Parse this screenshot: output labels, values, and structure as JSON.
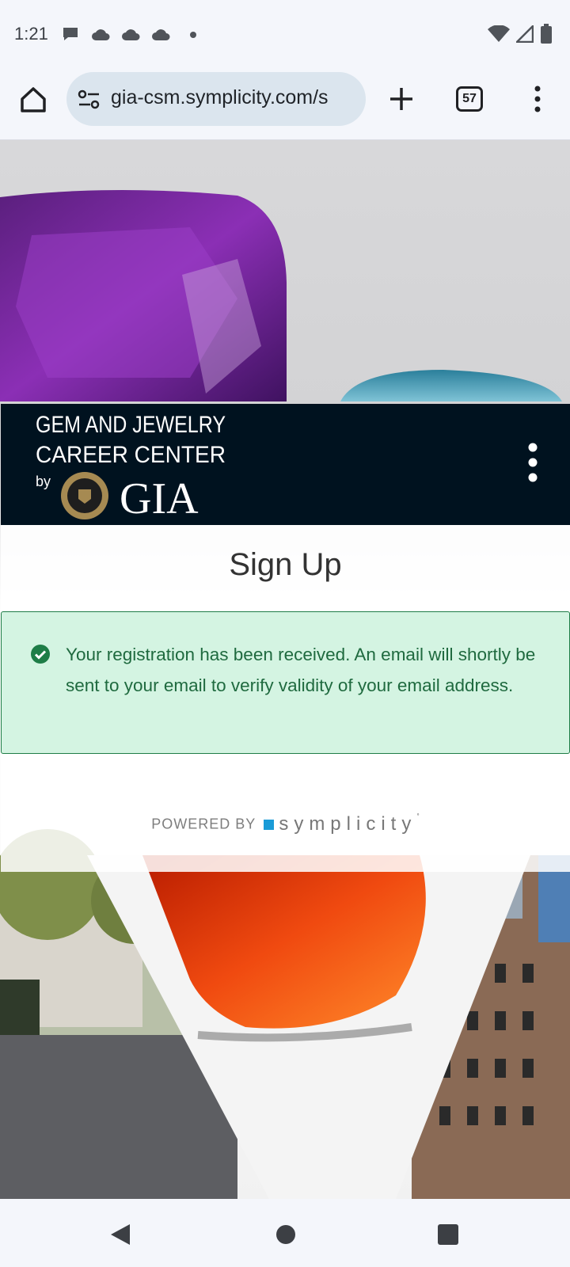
{
  "status_bar": {
    "time": "1:21",
    "notification_icons": [
      "chat-bubble-icon",
      "cloud-icon",
      "cloud-icon",
      "cloud-icon",
      "dot-icon"
    ],
    "right_icons": [
      "wifi-icon",
      "signal-icon",
      "battery-icon"
    ]
  },
  "browser": {
    "url": "gia-csm.symplicity.com/s",
    "tab_count": "57"
  },
  "site": {
    "logo_line1": "GEM AND JEWELRY",
    "logo_line2": "CAREER CENTER",
    "logo_by": "by",
    "logo_brand": "GIA",
    "title": "Sign Up",
    "alert_message": "Your registration has been received. An email will shortly be sent to your email to verify validity of your email address.",
    "powered_by": "POWERED BY",
    "powered_brand": "symplicity"
  },
  "colors": {
    "header_bg": "#00121f",
    "alert_bg": "#d4f4e2",
    "alert_text": "#1f6a3f",
    "symplicity_square": "#1a9bd7"
  }
}
